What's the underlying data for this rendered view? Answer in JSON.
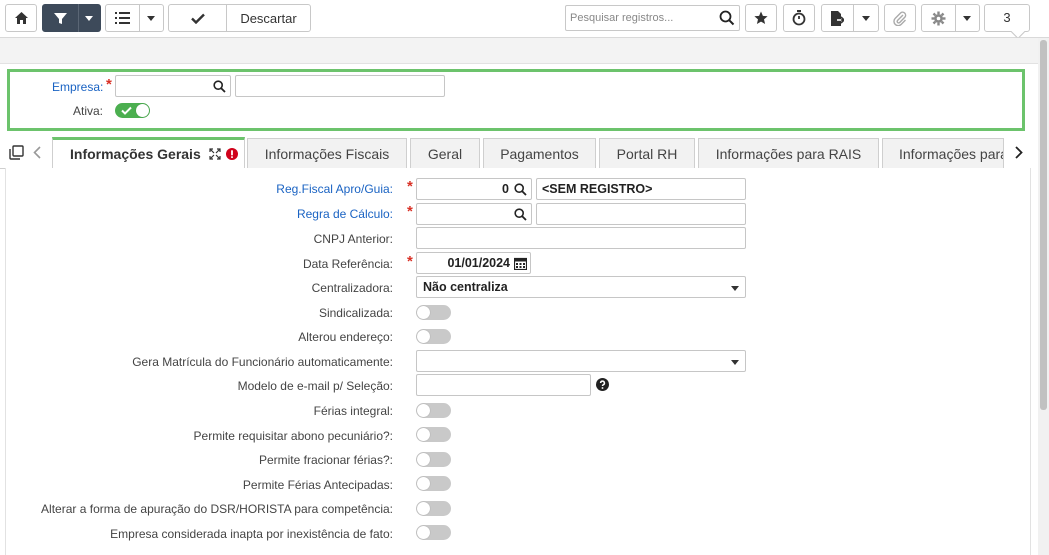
{
  "toolbar": {
    "home_icon": "home-icon",
    "filter_icon": "filter-icon",
    "list_icon": "list-icon",
    "confirm_icon": "check-icon",
    "discard_label": "Descartar",
    "search_placeholder": "Pesquisar registros...",
    "search_value": "",
    "record_count": "3"
  },
  "header": {
    "empresa_label": "Empresa:",
    "empresa_code": "",
    "empresa_name": "",
    "ativa_label": "Ativa:",
    "ativa_on": true
  },
  "tabs": [
    {
      "label": "Informações Gerais"
    },
    {
      "label": "Informações Fiscais"
    },
    {
      "label": "Geral"
    },
    {
      "label": "Pagamentos"
    },
    {
      "label": "Portal RH"
    },
    {
      "label": "Informações para RAIS"
    },
    {
      "label": "Informações para"
    }
  ],
  "form": {
    "reg_fiscal_label": "Reg.Fiscal Apro/Guia:",
    "reg_fiscal_code": "0",
    "reg_fiscal_desc": "<SEM REGISTRO>",
    "regra_calculo_label": "Regra de Cálculo:",
    "regra_calculo_code": "",
    "regra_calculo_desc": "",
    "cnpj_anterior_label": "CNPJ Anterior:",
    "cnpj_anterior_value": "",
    "data_referencia_label": "Data Referência:",
    "data_referencia_value": "01/01/2024",
    "centralizadora_label": "Centralizadora:",
    "centralizadora_value": "Não centraliza",
    "sindicalizada_label": "Sindicalizada:",
    "alterou_endereco_label": "Alterou endereço:",
    "gera_matricula_label": "Gera Matrícula do Funcionário automaticamente:",
    "gera_matricula_value": "",
    "modelo_email_label": "Modelo de e-mail p/ Seleção:",
    "modelo_email_value": "",
    "ferias_integral_label": "Férias integral:",
    "abono_label": "Permite requisitar abono pecuniário?:",
    "fracionar_label": "Permite fracionar férias?:",
    "antecipadas_label": "Permite Férias Antecipadas:",
    "dsr_label": "Alterar a forma de apuração do DSR/HORISTA para competência:",
    "inapta_label": "Empresa considerada inapta por inexistência de fato:"
  },
  "colors": {
    "accent_green": "#6cc36c",
    "toggle_on": "#4caf50",
    "label_blue": "#1a63c3",
    "required_red": "#d93025",
    "toolbar_dark": "#3d4a5a"
  }
}
